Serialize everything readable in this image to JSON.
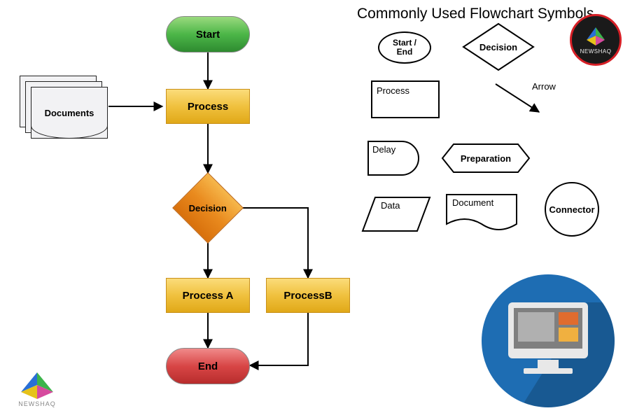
{
  "flowchart": {
    "start": "Start",
    "documents": "Documents",
    "process": "Process",
    "decision": "Decision",
    "processA": "Process A",
    "processB": "ProcessB",
    "end": "End"
  },
  "legend": {
    "title": "Commonly Used Flowchart Symbols",
    "start_end": "Start /\nEnd",
    "decision": "Decision",
    "process": "Process",
    "arrow": "Arrow",
    "delay": "Delay",
    "preparation": "Preparation",
    "data": "Data",
    "document": "Document",
    "connector": "Connector"
  },
  "brand": {
    "name": "NEWSHAQ"
  }
}
